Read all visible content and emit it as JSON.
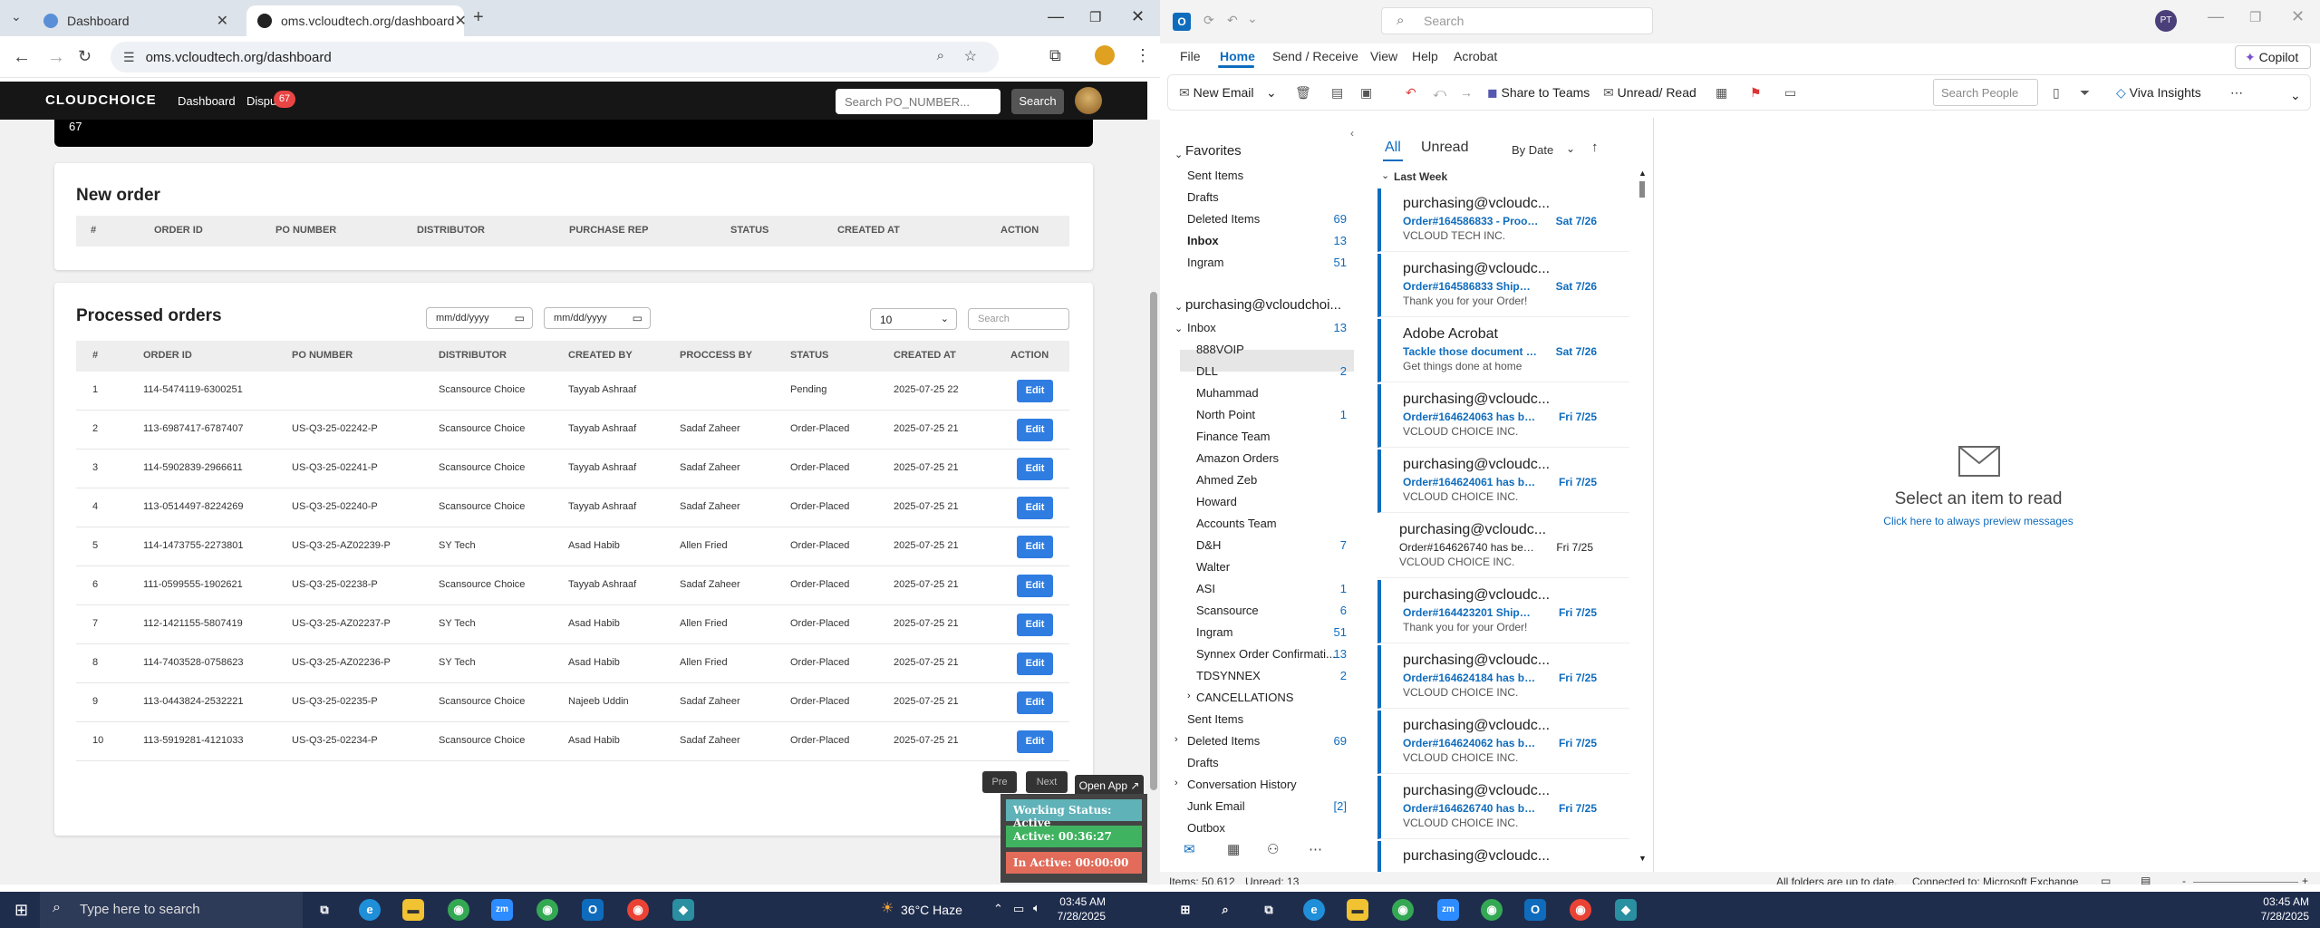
{
  "browser": {
    "tabs": [
      {
        "title": "Dashboard",
        "active": false
      },
      {
        "title": "oms.vcloudtech.org/dashboard",
        "active": true
      }
    ],
    "url": "oms.vcloudtech.org/dashboard"
  },
  "site": {
    "logo": "CLOUDCHOICE",
    "nav": {
      "dashboard": "Dashboard",
      "disputes": "Dispu",
      "disputes_badge": "67"
    },
    "search_placeholder": "Search PO_NUMBER...",
    "search_button": "Search",
    "top_stat": "67"
  },
  "new_order": {
    "title": "New order",
    "columns": [
      "#",
      "ORDER ID",
      "PO NUMBER",
      "DISTRIBUTOR",
      "PURCHASE REP",
      "STATUS",
      "CREATED AT",
      "ACTION"
    ]
  },
  "processed": {
    "title": "Processed orders",
    "date_from": "mm/dd/yyyy",
    "date_to": "mm/dd/yyyy",
    "page_size": "10",
    "search_placeholder": "Search",
    "columns": [
      "#",
      "ORDER ID",
      "PO NUMBER",
      "DISTRIBUTOR",
      "CREATED BY",
      "PROCCESS BY",
      "STATUS",
      "CREATED AT",
      "ACTION"
    ],
    "rows": [
      {
        "n": "1",
        "order": "114-5474119-6300251",
        "po": "",
        "dist": "Scansource Choice",
        "by": "Tayyab Ashraaf",
        "proc": "",
        "status": "Pending",
        "at": "2025-07-25 22",
        "action": "Edit"
      },
      {
        "n": "2",
        "order": "113-6987417-6787407",
        "po": "US-Q3-25-02242-P",
        "dist": "Scansource Choice",
        "by": "Tayyab Ashraaf",
        "proc": "Sadaf Zaheer",
        "status": "Order-Placed",
        "at": "2025-07-25 21",
        "action": "Edit"
      },
      {
        "n": "3",
        "order": "114-5902839-2966611",
        "po": "US-Q3-25-02241-P",
        "dist": "Scansource Choice",
        "by": "Tayyab Ashraaf",
        "proc": "Sadaf Zaheer",
        "status": "Order-Placed",
        "at": "2025-07-25 21",
        "action": "Edit"
      },
      {
        "n": "4",
        "order": "113-0514497-8224269",
        "po": "US-Q3-25-02240-P",
        "dist": "Scansource Choice",
        "by": "Tayyab Ashraaf",
        "proc": "Sadaf Zaheer",
        "status": "Order-Placed",
        "at": "2025-07-25 21",
        "action": "Edit"
      },
      {
        "n": "5",
        "order": "114-1473755-2273801",
        "po": "US-Q3-25-AZ02239-P",
        "dist": "SY Tech",
        "by": "Asad Habib",
        "proc": "Allen Fried",
        "status": "Order-Placed",
        "at": "2025-07-25 21",
        "action": "Edit"
      },
      {
        "n": "6",
        "order": "111-0599555-1902621",
        "po": "US-Q3-25-02238-P",
        "dist": "Scansource Choice",
        "by": "Tayyab Ashraaf",
        "proc": "Sadaf Zaheer",
        "status": "Order-Placed",
        "at": "2025-07-25 21",
        "action": "Edit"
      },
      {
        "n": "7",
        "order": "112-1421155-5807419",
        "po": "US-Q3-25-AZ02237-P",
        "dist": "SY Tech",
        "by": "Asad Habib",
        "proc": "Allen Fried",
        "status": "Order-Placed",
        "at": "2025-07-25 21",
        "action": "Edit"
      },
      {
        "n": "8",
        "order": "114-7403528-0758623",
        "po": "US-Q3-25-AZ02236-P",
        "dist": "SY Tech",
        "by": "Asad Habib",
        "proc": "Allen Fried",
        "status": "Order-Placed",
        "at": "2025-07-25 21",
        "action": "Edit"
      },
      {
        "n": "9",
        "order": "113-0443824-2532221",
        "po": "US-Q3-25-02235-P",
        "dist": "Scansource Choice",
        "by": "Najeeb Uddin",
        "proc": "Sadaf Zaheer",
        "status": "Order-Placed",
        "at": "2025-07-25 21",
        "action": "Edit"
      },
      {
        "n": "10",
        "order": "113-5919281-4121033",
        "po": "US-Q3-25-02234-P",
        "dist": "Scansource Choice",
        "by": "Asad Habib",
        "proc": "Sadaf Zaheer",
        "status": "Order-Placed",
        "at": "2025-07-25 21",
        "action": "Edit"
      }
    ],
    "prev": "Pre",
    "next": "Next"
  },
  "widget": {
    "open_app": "Open App ↗",
    "working_status": "Working Status: Active",
    "active": "Active: 00:36:27",
    "inactive": "In Active: 00:00:00",
    "colors": {
      "status": "#5fb2b8",
      "active": "#3fb35f",
      "inactive": "#e26b5a"
    }
  },
  "outlook": {
    "search_placeholder": "Search",
    "user_initials": "PT",
    "menu": [
      "File",
      "Home",
      "Send / Receive",
      "View",
      "Help",
      "Acrobat"
    ],
    "copilot": "Copilot",
    "ribbon": {
      "new_email": "New Email",
      "share_teams": "Share to Teams",
      "unread_read": "Unread/ Read",
      "search_people": "Search People",
      "viva": "Viva Insights"
    },
    "favorites_label": "Favorites",
    "favorites": [
      {
        "name": "Sent Items",
        "count": ""
      },
      {
        "name": "Drafts",
        "count": ""
      },
      {
        "name": "Deleted Items",
        "count": "69"
      },
      {
        "name": "Inbox",
        "count": "13"
      },
      {
        "name": "Ingram",
        "count": "51"
      }
    ],
    "account": "purchasing@vcloudchoi...",
    "inbox": {
      "name": "Inbox",
      "count": "13"
    },
    "subfolders": [
      {
        "name": "888VOIP",
        "count": ""
      },
      {
        "name": "DLL",
        "count": "2"
      },
      {
        "name": "Muhammad",
        "count": ""
      },
      {
        "name": "North Point",
        "count": "1"
      },
      {
        "name": "Finance Team",
        "count": ""
      },
      {
        "name": "Amazon Orders",
        "count": ""
      },
      {
        "name": "Ahmed Zeb",
        "count": ""
      },
      {
        "name": "Howard",
        "count": ""
      },
      {
        "name": "Accounts Team",
        "count": ""
      },
      {
        "name": "D&H",
        "count": "7"
      },
      {
        "name": "Walter",
        "count": ""
      },
      {
        "name": "ASI",
        "count": "1"
      },
      {
        "name": "Scansource",
        "count": "6"
      },
      {
        "name": "Ingram",
        "count": "51"
      },
      {
        "name": "Synnex Order Confirmati...",
        "count": "13"
      },
      {
        "name": "TDSYNNEX",
        "count": "2"
      }
    ],
    "cancellations": "CANCELLATIONS",
    "rootfolders": [
      {
        "name": "Sent Items",
        "count": "",
        "exp": false
      },
      {
        "name": "Deleted Items",
        "count": "69",
        "exp": true
      },
      {
        "name": "Drafts",
        "count": "",
        "exp": false
      },
      {
        "name": "Conversation History",
        "count": "",
        "exp": true
      },
      {
        "name": "Junk Email",
        "count": "[2]",
        "exp": false
      },
      {
        "name": "Outbox",
        "count": "",
        "exp": false
      }
    ],
    "list_tabs": {
      "all": "All",
      "unread": "Unread",
      "sort": "By Date"
    },
    "group": "Last Week",
    "messages": [
      {
        "sender": "purchasing@vcloudc...",
        "subject": "Order#164586833 - Proof o...",
        "date": "Sat 7/26",
        "preview": "VCLOUD TECH INC.",
        "unread": true
      },
      {
        "sender": "purchasing@vcloudc...",
        "subject": "Order#164586833 Shipmen...",
        "date": "Sat 7/26",
        "preview": "Thank you for your Order!",
        "unread": true
      },
      {
        "sender": "Adobe Acrobat",
        "subject": "Tackle those document tas...",
        "date": "Sat 7/26",
        "preview": "Get things done at home",
        "unread": true
      },
      {
        "sender": "purchasing@vcloudc...",
        "subject": "Order#164624063 has been...",
        "date": "Fri 7/25",
        "preview": "VCLOUD CHOICE INC.",
        "unread": true
      },
      {
        "sender": "purchasing@vcloudc...",
        "subject": "Order#164624061 has been...",
        "date": "Fri 7/25",
        "preview": "VCLOUD CHOICE INC.",
        "unread": true
      },
      {
        "sender": "purchasing@vcloudc...",
        "subject": "Order#164626740 has bee...",
        "date": "Fri 7/25",
        "preview": "VCLOUD CHOICE INC.",
        "unread": false
      },
      {
        "sender": "purchasing@vcloudc...",
        "subject": "Order#164423201 Shipmen...",
        "date": "Fri 7/25",
        "preview": "Thank you for your Order!",
        "unread": true
      },
      {
        "sender": "purchasing@vcloudc...",
        "subject": "Order#164624184 has been...",
        "date": "Fri 7/25",
        "preview": "VCLOUD CHOICE INC.",
        "unread": true
      },
      {
        "sender": "purchasing@vcloudc...",
        "subject": "Order#164624062 has been...",
        "date": "Fri 7/25",
        "preview": "VCLOUD CHOICE INC.",
        "unread": true
      },
      {
        "sender": "purchasing@vcloudc...",
        "subject": "Order#164626740 has been...",
        "date": "Fri 7/25",
        "preview": "VCLOUD CHOICE INC.",
        "unread": true
      },
      {
        "sender": "purchasing@vcloudc...",
        "subject": "",
        "date": "",
        "preview": "",
        "unread": true
      }
    ],
    "reading": {
      "title": "Select an item to read",
      "link": "Click here to always preview messages"
    },
    "status": {
      "items": "Items: 50,612",
      "unread": "Unread: 13",
      "sync": "All folders are up to date.",
      "connected": "Connected to: Microsoft Exchange"
    }
  },
  "taskbar": {
    "search": "Type here to search",
    "weather": "36°C  Haze",
    "time1": "03:45 AM",
    "date1": "7/28/2025",
    "time2": "03:45 AM",
    "date2": "7/28/2025"
  }
}
